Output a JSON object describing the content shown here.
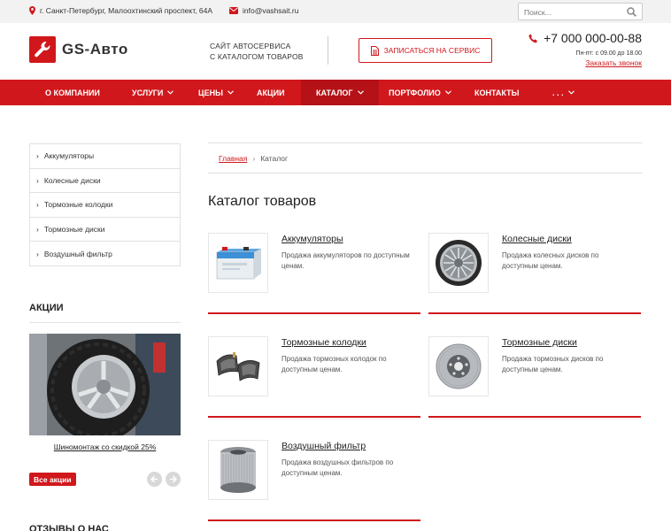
{
  "topbar": {
    "address": "г. Санкт-Петербург, Малоохтинский проспект, 64А",
    "email": "info@vashsait.ru",
    "search_placeholder": "Поиск..."
  },
  "header": {
    "logo_text": "GS-Авто",
    "slogan_line1": "САЙТ АВТОСЕРВИСА",
    "slogan_line2": "С КАТАЛОГОМ ТОВАРОВ",
    "cta_label": "ЗАПИСАТЬСЯ НА СЕРВИС",
    "phone": "+7 000 000-00-88",
    "hours": "Пн-пт: с 09.00 до 18.00",
    "callback": "Заказать звонок"
  },
  "nav": {
    "items": [
      {
        "label": "О компании",
        "dropdown": false
      },
      {
        "label": "Услуги",
        "dropdown": true
      },
      {
        "label": "Цены",
        "dropdown": true
      },
      {
        "label": "Акции",
        "dropdown": false
      },
      {
        "label": "Каталог",
        "dropdown": true,
        "active": true
      },
      {
        "label": "Портфолио",
        "dropdown": true
      },
      {
        "label": "Контакты",
        "dropdown": false
      },
      {
        "label": ". . .",
        "dropdown": true
      }
    ]
  },
  "sidebar": {
    "categories": [
      "Аккумуляторы",
      "Колесные диски",
      "Тормозные колодки",
      "Тормозные диски",
      "Воздушный фильтр"
    ],
    "promo_title": "АКЦИИ",
    "promo_caption": "Шиномонтаж со скидкой 25%",
    "all_promos": "Все акции",
    "reviews_title": "ОТЗЫВЫ О НАС"
  },
  "main": {
    "breadcrumb_home": "Главная",
    "breadcrumb_sep": "›",
    "breadcrumb_current": "Каталог",
    "title": "Каталог товаров",
    "products": [
      {
        "title": "Аккумуляторы",
        "desc": "Продажа аккумуляторов по доступным ценам.",
        "image": "battery"
      },
      {
        "title": "Колесные диски",
        "desc": "Продажа колесных дисков по доступным ценам.",
        "image": "wheel-rim"
      },
      {
        "title": "Тормозные колодки",
        "desc": "Продажа тормозных колодок по доступным ценам.",
        "image": "brake-pads"
      },
      {
        "title": "Тормозные диски",
        "desc": "Продажа тормозных дисков по доступным ценам.",
        "image": "brake-disc"
      },
      {
        "title": "Воздушный фильтр",
        "desc": "Продажа воздушных фильтров по доступным ценам.",
        "image": "air-filter"
      }
    ]
  },
  "colors": {
    "accent": "#d0181c",
    "accent_dark": "#b41216",
    "topbar_bg": "#f2f2f2"
  }
}
